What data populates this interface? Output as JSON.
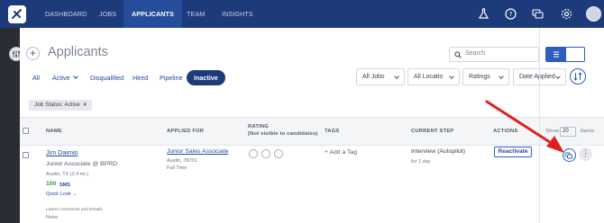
{
  "nav": {
    "items": [
      "DASHBOARD",
      "JOBS",
      "APPLICANTS",
      "TEAM",
      "INSIGHTS"
    ],
    "active": "APPLICANTS"
  },
  "page": {
    "title": "Applicants",
    "search_placeholder": "Search"
  },
  "tabs": [
    "All",
    "Active",
    "Disqualified",
    "Hired",
    "Pipeline",
    "Inactive"
  ],
  "active_tab": "Inactive",
  "filters": {
    "jobs": "All Jobs",
    "locations": "All Locatio",
    "ratings": "Ratings",
    "date": "Date Applied"
  },
  "filter_chip": "Job Status: Active",
  "filter_chip_close": "×",
  "add_button": "+",
  "table": {
    "headers": {
      "name": "NAME",
      "applied_for": "APPLIED FOR",
      "rating": "RATING",
      "rating_note": "(Not visible to candidates)",
      "tags": "TAGS",
      "current_step": "CURRENT STEP",
      "actions": "ACTIONS",
      "show": "Show",
      "show_count": "20",
      "items": "Items"
    },
    "row": {
      "name": "Jim Daimio",
      "title": "Junior Associate @ BPRD",
      "location": "Austin, TX (2.4 mi.)",
      "score": "100",
      "sms": "SMS",
      "quick_look": "Quick Look →",
      "job": "Junior Sales Associate",
      "job_location": "Austin, 78701",
      "job_type": "Full Time",
      "add_tag": "+ Add a Tag",
      "step": "Interview (Autopilot)",
      "step_duration": "for 1 day",
      "action": "Reactivate",
      "more": "⋮"
    },
    "comments_label": "Latest Comments and Emails",
    "comments_value": "None"
  },
  "colors": {
    "nav_bg": "#1d3a7a",
    "accent": "#2e5dc0",
    "arrow": "#e02020",
    "score": "#2e9a3c"
  }
}
